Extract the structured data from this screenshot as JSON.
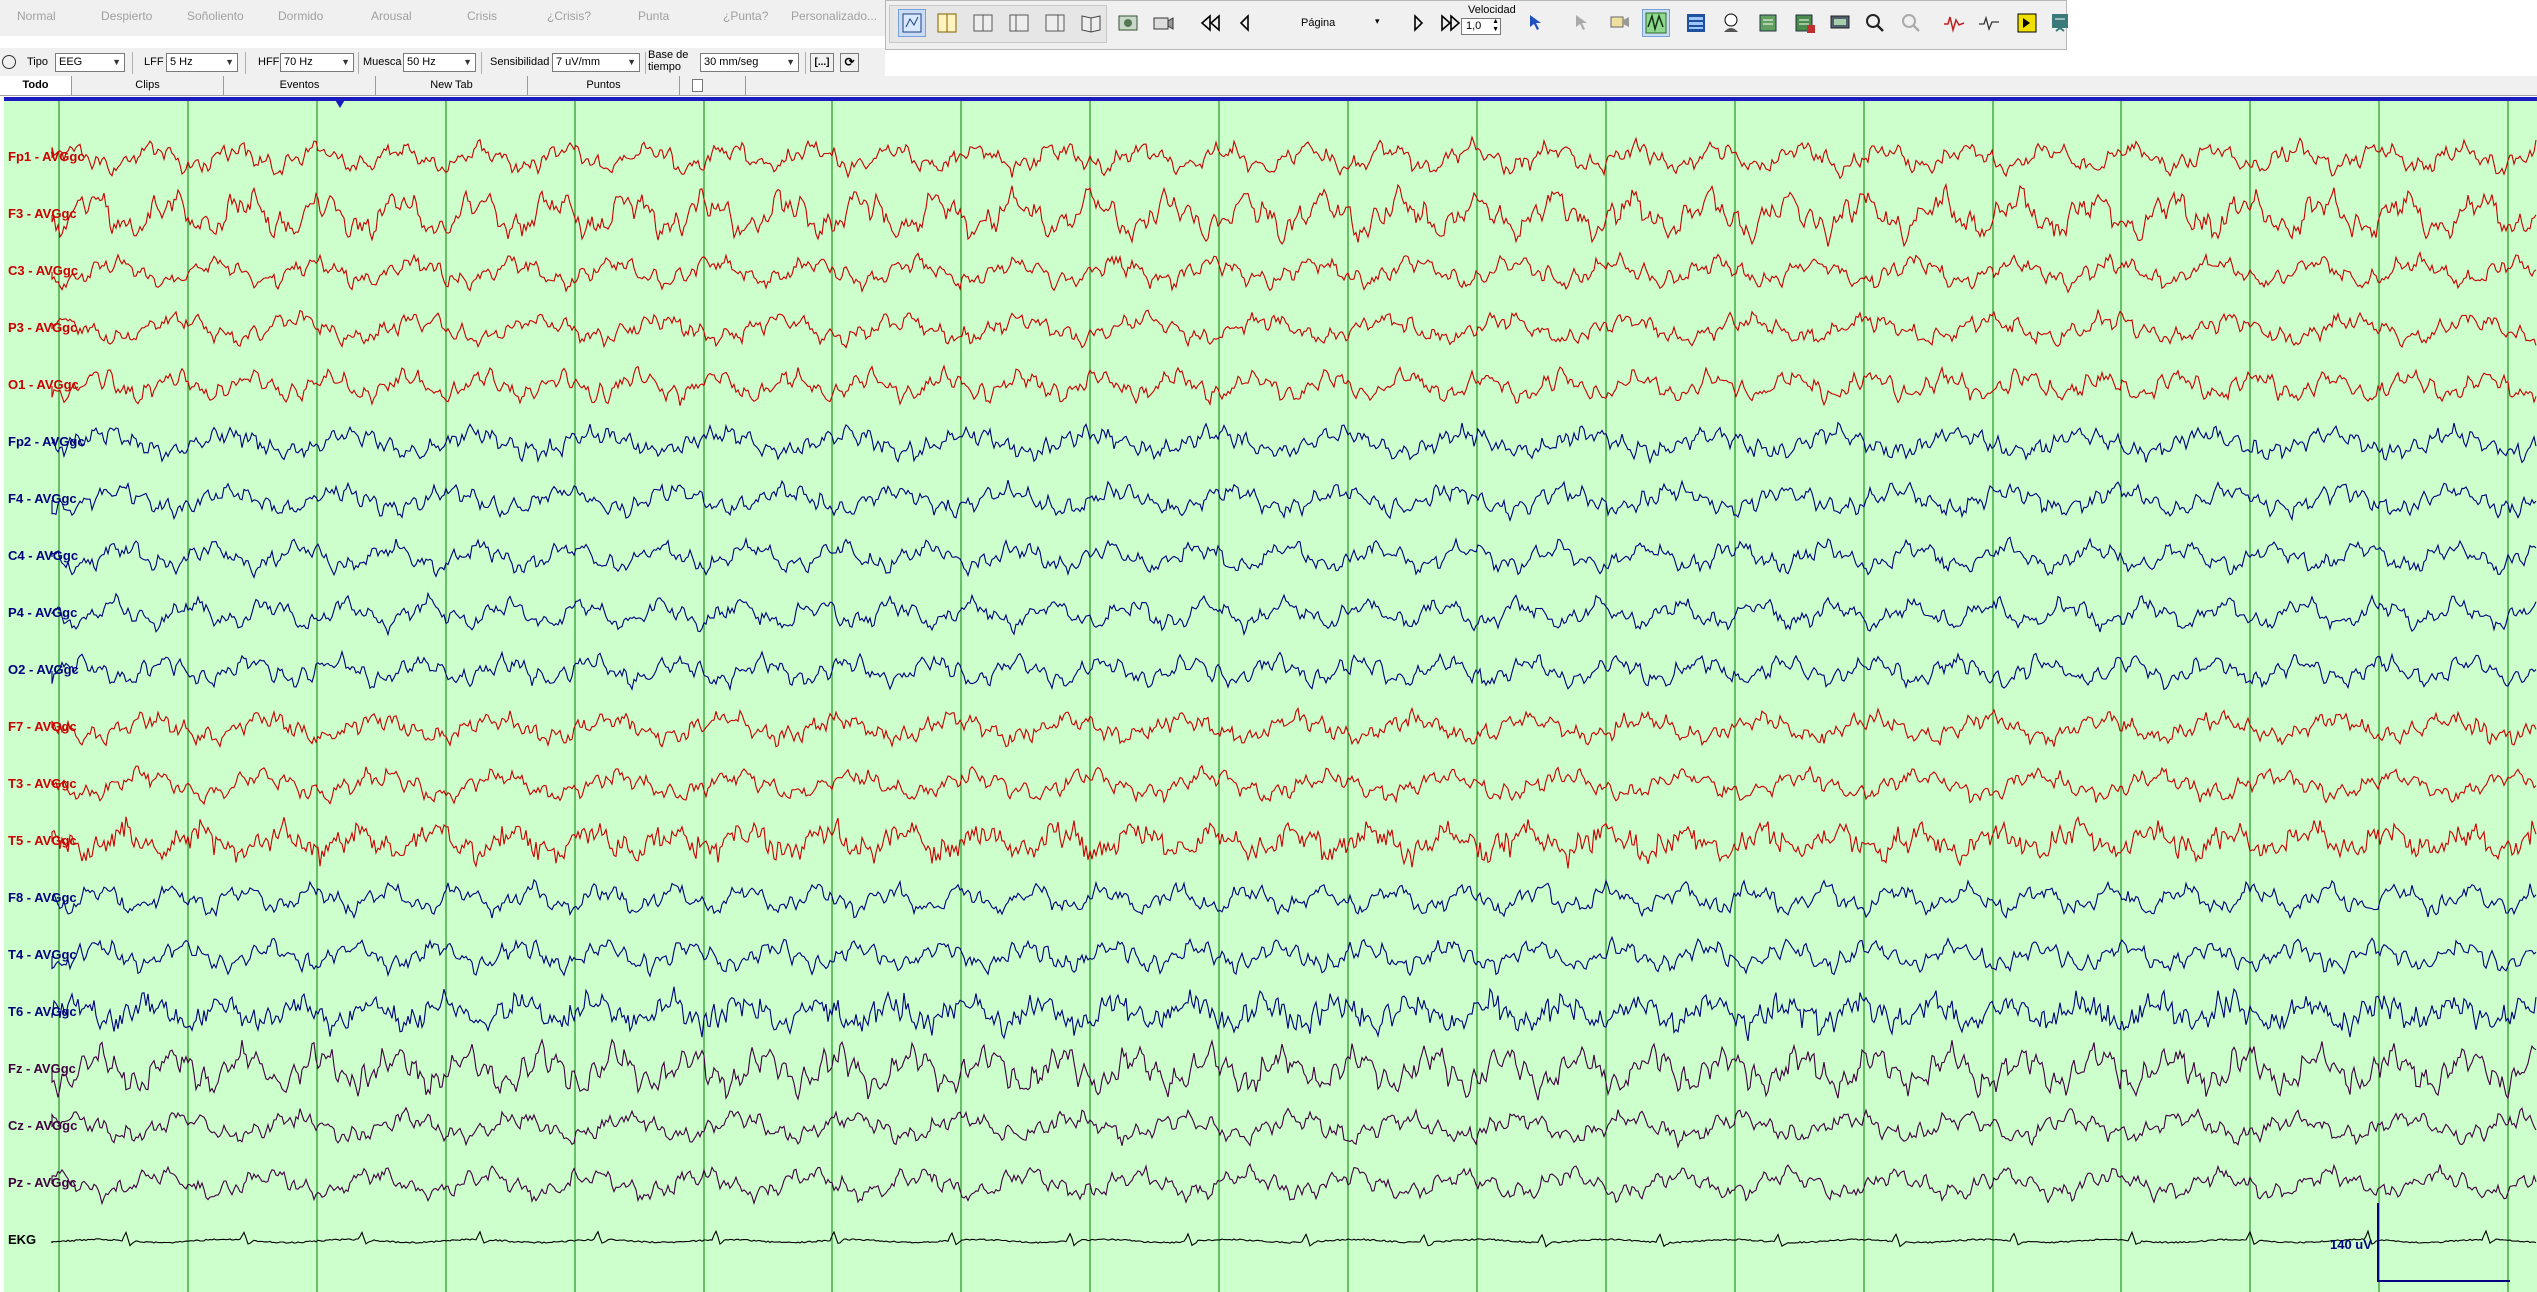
{
  "event_bar": {
    "items": [
      "Normal",
      "Despierto",
      "Soñoliento",
      "Dormido",
      "Arousal",
      "Crisis",
      "¿Crisis?",
      "Punta",
      "¿Punta?",
      "Personalizado..."
    ]
  },
  "toolbar": {
    "page_label": "Página",
    "speed_label": "Velocidad",
    "speed_value": "1,0",
    "icons": [
      "view-select-icon",
      "montage-icon",
      "panel-icon",
      "split-icon",
      "compare-icon",
      "book-icon",
      "record-icon",
      "camera-icon",
      "rewind-icon",
      "step-back-icon",
      "step-forward-icon",
      "fast-forward-icon",
      "cursor-icon",
      "marker-icon",
      "video-icon",
      "spike-icon",
      "map-icon",
      "patient-icon",
      "report-icon",
      "export-icon",
      "print-icon",
      "zoom-in-icon",
      "zoom-out-icon",
      "waveform-icon",
      "pulse-icon",
      "flag-icon",
      "settings-icon"
    ]
  },
  "settings": {
    "tipo_label": "Tipo",
    "tipo_value": "EEG",
    "lff_label": "LFF",
    "lff_value": "5 Hz",
    "hff_label": "HFF",
    "hff_value": "70 Hz",
    "muesca_label": "Muesca",
    "muesca_value": "50 Hz",
    "sens_label": "Sensibilidad",
    "sens_value": "7 uV/mm",
    "base_label_1": "Base de",
    "base_label_2": "tiempo",
    "base_value": "30 mm/seg",
    "bracket_btn": "[...]"
  },
  "tabs": [
    "Todo",
    "Clips",
    "Eventos",
    "New Tab",
    "Puntos"
  ],
  "eeg": {
    "channels": [
      {
        "label": "Fp1 - AVGgc",
        "color": "#cc0000"
      },
      {
        "label": "F3 - AVGgc",
        "color": "#cc0000"
      },
      {
        "label": "C3 - AVGgc",
        "color": "#cc0000"
      },
      {
        "label": "P3 - AVGgc",
        "color": "#cc0000"
      },
      {
        "label": "O1 - AVGgc",
        "color": "#cc0000"
      },
      {
        "label": "Fp2 - AVGgc",
        "color": "#000080"
      },
      {
        "label": "F4 - AVGgc",
        "color": "#000080"
      },
      {
        "label": "C4 - AVGgc",
        "color": "#000080"
      },
      {
        "label": "P4 - AVGgc",
        "color": "#000080"
      },
      {
        "label": "O2 - AVGgc",
        "color": "#000080"
      },
      {
        "label": "F7 - AVGgc",
        "color": "#cc0000"
      },
      {
        "label": "T3 - AVGgc",
        "color": "#cc0000"
      },
      {
        "label": "T5 - AVGgc",
        "color": "#cc0000"
      },
      {
        "label": "F8 - AVGgc",
        "color": "#000080"
      },
      {
        "label": "T4 - AVGgc",
        "color": "#000080"
      },
      {
        "label": "T6 - AVGgc",
        "color": "#000080"
      },
      {
        "label": "Fz - AVGgc",
        "color": "#400040"
      },
      {
        "label": "Cz - AVGgc",
        "color": "#400040"
      },
      {
        "label": "Pz - AVGgc",
        "color": "#400040"
      },
      {
        "label": "EKG",
        "color": "#000000"
      }
    ],
    "scale_label": "140 uV",
    "background_color": "#ccffcc",
    "gridline_color": "#008000",
    "second_lines": 20
  }
}
